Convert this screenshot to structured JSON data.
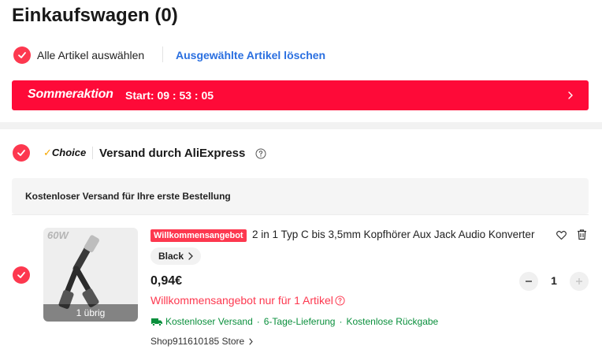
{
  "cart": {
    "title": "Einkaufswagen (0)",
    "select_all_label": "Alle Artikel auswählen",
    "delete_selected_label": "Ausgewählte Artikel löschen"
  },
  "promo": {
    "brand": "Sommeraktion",
    "start_text": "Start: 09 : 53 : 05",
    "color": "#fe0a38"
  },
  "store_group": {
    "choice_label": "Choice",
    "shipping_by": "Versand durch AliExpress",
    "free_shipping_note": "Kostenloser Versand für Ihre erste Bestellung"
  },
  "item": {
    "image_tag": "60W",
    "stock_overlay": "1 übrig",
    "welcome_badge": "Willkommensangebot",
    "title": "2 in 1 Typ C bis 3,5mm Kopfhörer Aux Jack Audio Konverter",
    "variant": "Black",
    "price": "0,94€",
    "quantity": "1",
    "offer_note": "Willkommensangebot nur für 1 Artikel",
    "delivery": {
      "free_shipping": "Kostenloser Versand",
      "delivery_time": "6-Tage-Lieferung",
      "free_returns": "Kostenlose Rückgabe"
    },
    "store_name": "Shop911610185 Store"
  },
  "colors": {
    "accent_red": "#fd384f",
    "link_blue": "#2a6fe0",
    "delivery_green": "#0a8f3c"
  }
}
